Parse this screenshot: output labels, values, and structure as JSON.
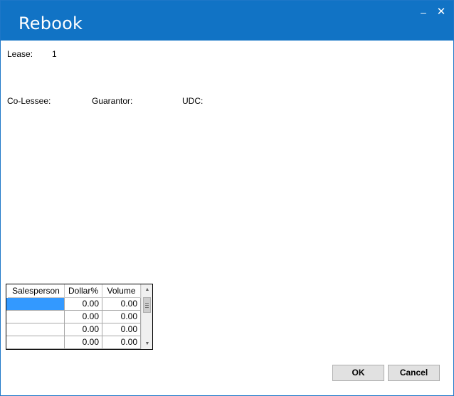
{
  "window": {
    "title": "Rebook",
    "minimize_glyph": "–",
    "close_glyph": "✕"
  },
  "lease": {
    "label": "Lease:",
    "value": "1"
  },
  "parties": {
    "colessee_label": "Co-Lessee:",
    "guarantor_label": "Guarantor:",
    "udc_label": "UDC:"
  },
  "grid": {
    "columns": [
      "Salesperson",
      "Dollar%",
      "Volume"
    ],
    "rows": [
      {
        "salesperson": "",
        "dollar": "0.00",
        "volume": "0.00"
      },
      {
        "salesperson": "",
        "dollar": "0.00",
        "volume": "0.00"
      },
      {
        "salesperson": "",
        "dollar": "0.00",
        "volume": "0.00"
      },
      {
        "salesperson": "",
        "dollar": "0.00",
        "volume": "0.00"
      }
    ],
    "scroll_up_glyph": "▲",
    "scroll_down_glyph": "▼"
  },
  "buttons": {
    "ok": "OK",
    "cancel": "Cancel"
  },
  "colors": {
    "titlebar": "#1173c5",
    "selection": "#3399ff",
    "button": "#e1e1e1"
  }
}
